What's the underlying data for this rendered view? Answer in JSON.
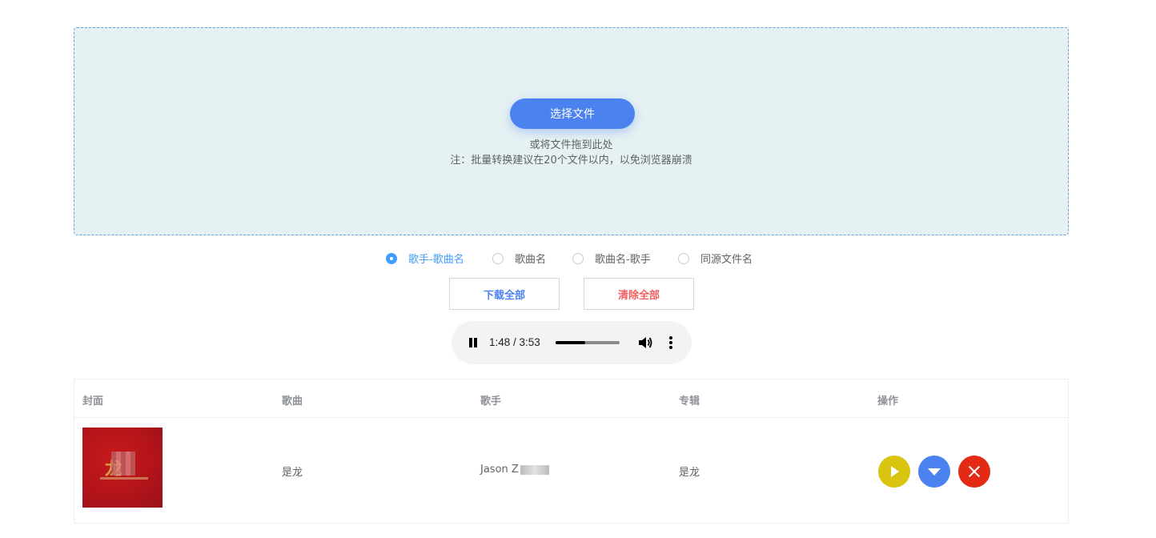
{
  "upload": {
    "button_label": "选择文件",
    "drag_hint": "或将文件拖到此处",
    "note": "注：批量转换建议在20个文件以内，以免浏览器崩溃"
  },
  "naming_options": [
    {
      "label": "歌手-歌曲名",
      "checked": true
    },
    {
      "label": "歌曲名",
      "checked": false
    },
    {
      "label": "歌曲名-歌手",
      "checked": false
    },
    {
      "label": "同源文件名",
      "checked": false
    }
  ],
  "actions": {
    "download_all": "下载全部",
    "clear_all": "清除全部"
  },
  "player": {
    "time": "1:48 / 3:53",
    "progress": 0.46
  },
  "table": {
    "headers": [
      "封面",
      "歌曲",
      "歌手",
      "专辑",
      "操作"
    ],
    "rows": [
      {
        "song": "是龙",
        "singer": "Jason Z",
        "album": "是龙"
      }
    ]
  },
  "colors": {
    "primary": "#4b82f0",
    "danger": "#ef5f62",
    "play": "#d9c40f",
    "delete": "#e32a14",
    "radio_checked": "#409eff"
  }
}
